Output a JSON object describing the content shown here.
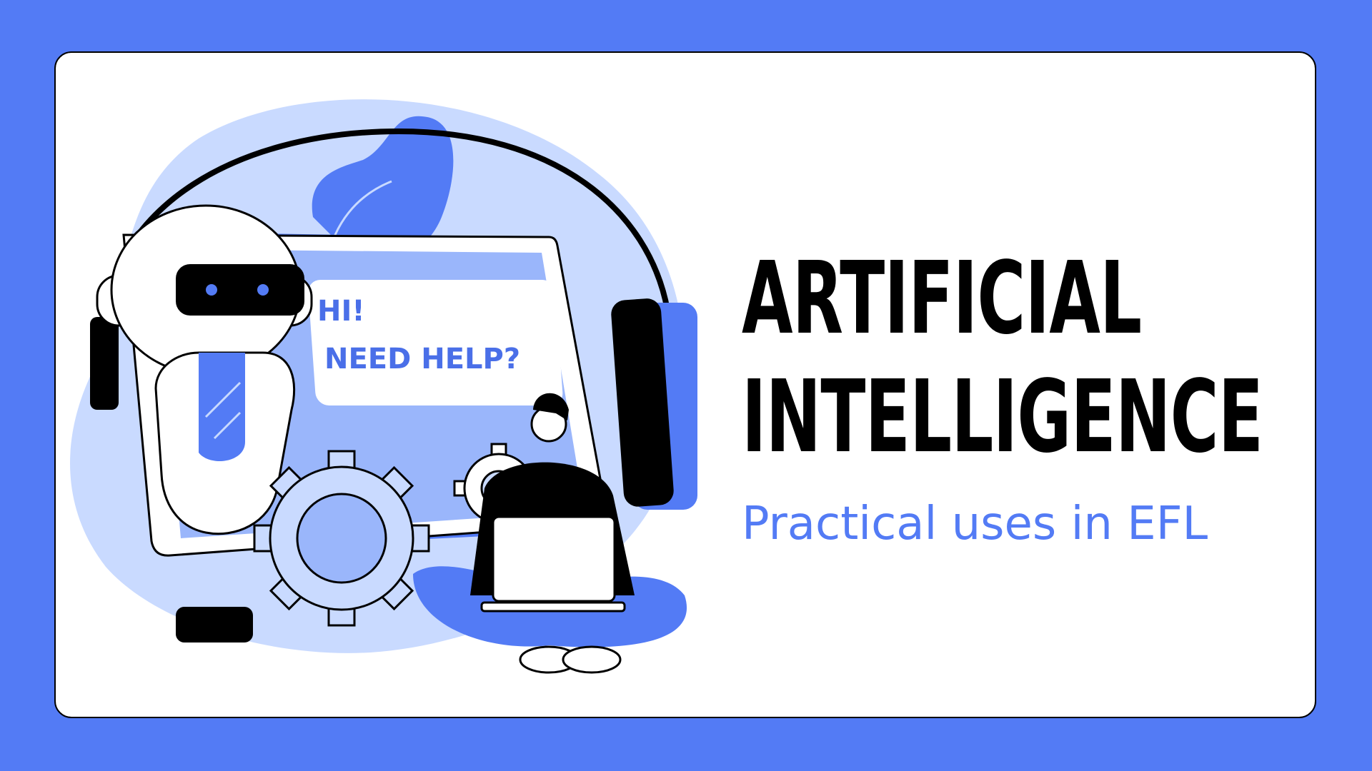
{
  "slide": {
    "title_line_1": "ARTIFICIAL",
    "title_line_2": "INTELLIGENCE",
    "subtitle": "Practical uses in EFL"
  },
  "chat_bubble": {
    "line_1": "HI!",
    "line_2": "NEED HELP?"
  },
  "colors": {
    "frame_blue": "#537bf5",
    "light_blue": "#c9daff",
    "mid_blue": "#9ab6fb",
    "ink": "#000000"
  },
  "icons": [
    "robot-icon",
    "gear-icon",
    "headphones-icon",
    "person-with-laptop-icon",
    "leaf-icon"
  ]
}
